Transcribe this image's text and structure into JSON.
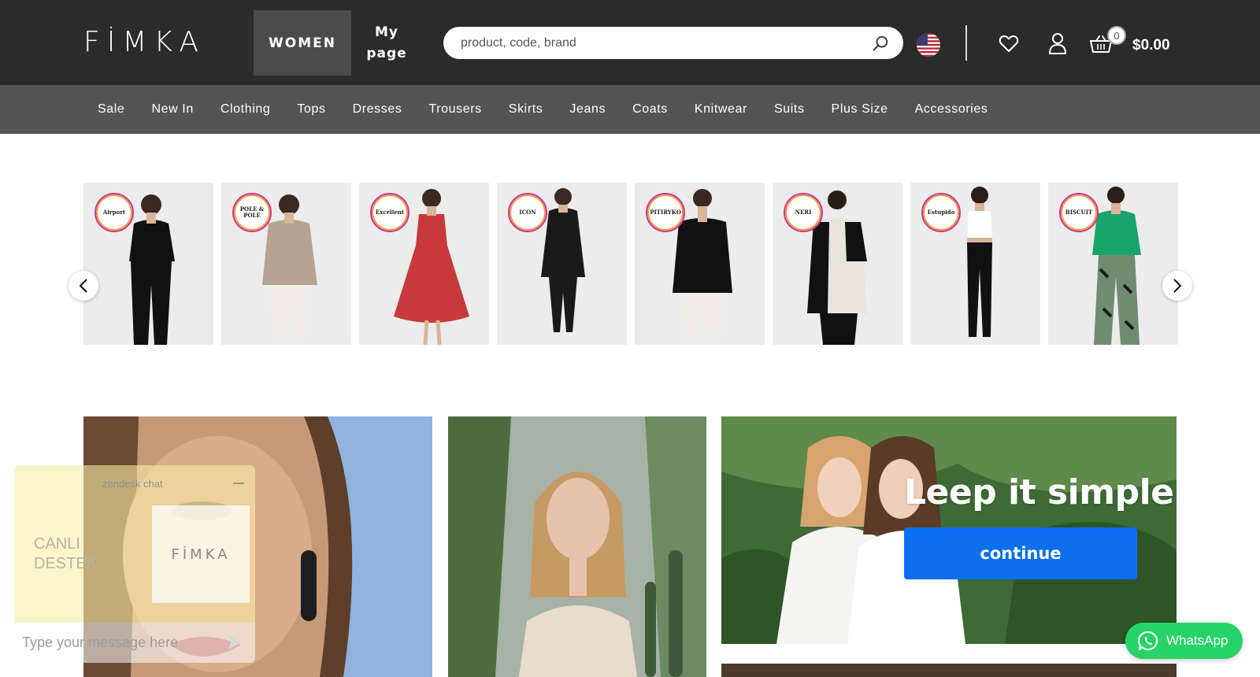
{
  "header": {
    "logo": "FİMKA",
    "nav_women": "WOMEN",
    "nav_mypage": "My page",
    "search_placeholder": "product, code, brand",
    "cart_count": "0",
    "cart_total": "$0.00"
  },
  "categories": [
    "Sale",
    "New In",
    "Clothing",
    "Tops",
    "Dresses",
    "Trousers",
    "Skirts",
    "Jeans",
    "Coats",
    "Knitwear",
    "Suits",
    "Plus Size",
    "Accessories"
  ],
  "brands": [
    {
      "badge": "Airport",
      "top": "#111111",
      "bottom": "#111111"
    },
    {
      "badge": "POLE & POLE",
      "top": "#b7a392",
      "bottom": "#f1ede6"
    },
    {
      "badge": "Excellent",
      "top": "#c7393a",
      "bottom": "#c7393a"
    },
    {
      "badge": "ICON",
      "top": "#1a1a1a",
      "bottom": "#1a1a1a"
    },
    {
      "badge": "PITIRYKO",
      "top": "#111111",
      "bottom": "#f1ede6"
    },
    {
      "badge": "NERI",
      "top": "#e8e4dc",
      "bottom": "#111111"
    },
    {
      "badge": "Estupido",
      "top": "#ffffff",
      "bottom": "#111111"
    },
    {
      "badge": "BISCUIT",
      "top": "#1aa36b",
      "bottom": "#6f8c73"
    }
  ],
  "hero": {
    "slogan": "Leep it simple",
    "button": "continue"
  },
  "chat": {
    "title": "zendesk chat",
    "label": "CANLI DESTEK",
    "logo": "FİMKA",
    "placeholder": "Type your message here"
  },
  "whatsapp": {
    "label": "WhatsApp"
  },
  "colors": {
    "header_bg": "#2b2b2b",
    "category_bar_bg": "#545454",
    "women_tab_bg": "#4b4b4b",
    "button_blue": "#0c6ff0",
    "whatsapp_green": "#25d366"
  }
}
